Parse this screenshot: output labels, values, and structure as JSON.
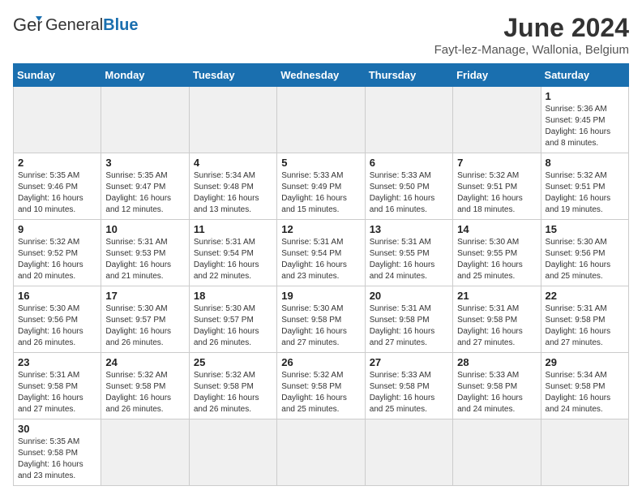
{
  "header": {
    "logo_general": "General",
    "logo_blue": "Blue",
    "title": "June 2024",
    "location": "Fayt-lez-Manage, Wallonia, Belgium"
  },
  "days_of_week": [
    "Sunday",
    "Monday",
    "Tuesday",
    "Wednesday",
    "Thursday",
    "Friday",
    "Saturday"
  ],
  "weeks": [
    [
      {
        "day": "",
        "info": ""
      },
      {
        "day": "",
        "info": ""
      },
      {
        "day": "",
        "info": ""
      },
      {
        "day": "",
        "info": ""
      },
      {
        "day": "",
        "info": ""
      },
      {
        "day": "",
        "info": ""
      },
      {
        "day": "1",
        "info": "Sunrise: 5:36 AM\nSunset: 9:45 PM\nDaylight: 16 hours and 8 minutes."
      }
    ],
    [
      {
        "day": "2",
        "info": "Sunrise: 5:35 AM\nSunset: 9:46 PM\nDaylight: 16 hours and 10 minutes."
      },
      {
        "day": "3",
        "info": "Sunrise: 5:35 AM\nSunset: 9:47 PM\nDaylight: 16 hours and 12 minutes."
      },
      {
        "day": "4",
        "info": "Sunrise: 5:34 AM\nSunset: 9:48 PM\nDaylight: 16 hours and 13 minutes."
      },
      {
        "day": "5",
        "info": "Sunrise: 5:33 AM\nSunset: 9:49 PM\nDaylight: 16 hours and 15 minutes."
      },
      {
        "day": "6",
        "info": "Sunrise: 5:33 AM\nSunset: 9:50 PM\nDaylight: 16 hours and 16 minutes."
      },
      {
        "day": "7",
        "info": "Sunrise: 5:32 AM\nSunset: 9:51 PM\nDaylight: 16 hours and 18 minutes."
      },
      {
        "day": "8",
        "info": "Sunrise: 5:32 AM\nSunset: 9:51 PM\nDaylight: 16 hours and 19 minutes."
      }
    ],
    [
      {
        "day": "9",
        "info": "Sunrise: 5:32 AM\nSunset: 9:52 PM\nDaylight: 16 hours and 20 minutes."
      },
      {
        "day": "10",
        "info": "Sunrise: 5:31 AM\nSunset: 9:53 PM\nDaylight: 16 hours and 21 minutes."
      },
      {
        "day": "11",
        "info": "Sunrise: 5:31 AM\nSunset: 9:54 PM\nDaylight: 16 hours and 22 minutes."
      },
      {
        "day": "12",
        "info": "Sunrise: 5:31 AM\nSunset: 9:54 PM\nDaylight: 16 hours and 23 minutes."
      },
      {
        "day": "13",
        "info": "Sunrise: 5:31 AM\nSunset: 9:55 PM\nDaylight: 16 hours and 24 minutes."
      },
      {
        "day": "14",
        "info": "Sunrise: 5:30 AM\nSunset: 9:55 PM\nDaylight: 16 hours and 25 minutes."
      },
      {
        "day": "15",
        "info": "Sunrise: 5:30 AM\nSunset: 9:56 PM\nDaylight: 16 hours and 25 minutes."
      }
    ],
    [
      {
        "day": "16",
        "info": "Sunrise: 5:30 AM\nSunset: 9:56 PM\nDaylight: 16 hours and 26 minutes."
      },
      {
        "day": "17",
        "info": "Sunrise: 5:30 AM\nSunset: 9:57 PM\nDaylight: 16 hours and 26 minutes."
      },
      {
        "day": "18",
        "info": "Sunrise: 5:30 AM\nSunset: 9:57 PM\nDaylight: 16 hours and 26 minutes."
      },
      {
        "day": "19",
        "info": "Sunrise: 5:30 AM\nSunset: 9:58 PM\nDaylight: 16 hours and 27 minutes."
      },
      {
        "day": "20",
        "info": "Sunrise: 5:31 AM\nSunset: 9:58 PM\nDaylight: 16 hours and 27 minutes."
      },
      {
        "day": "21",
        "info": "Sunrise: 5:31 AM\nSunset: 9:58 PM\nDaylight: 16 hours and 27 minutes."
      },
      {
        "day": "22",
        "info": "Sunrise: 5:31 AM\nSunset: 9:58 PM\nDaylight: 16 hours and 27 minutes."
      }
    ],
    [
      {
        "day": "23",
        "info": "Sunrise: 5:31 AM\nSunset: 9:58 PM\nDaylight: 16 hours and 27 minutes."
      },
      {
        "day": "24",
        "info": "Sunrise: 5:32 AM\nSunset: 9:58 PM\nDaylight: 16 hours and 26 minutes."
      },
      {
        "day": "25",
        "info": "Sunrise: 5:32 AM\nSunset: 9:58 PM\nDaylight: 16 hours and 26 minutes."
      },
      {
        "day": "26",
        "info": "Sunrise: 5:32 AM\nSunset: 9:58 PM\nDaylight: 16 hours and 25 minutes."
      },
      {
        "day": "27",
        "info": "Sunrise: 5:33 AM\nSunset: 9:58 PM\nDaylight: 16 hours and 25 minutes."
      },
      {
        "day": "28",
        "info": "Sunrise: 5:33 AM\nSunset: 9:58 PM\nDaylight: 16 hours and 24 minutes."
      },
      {
        "day": "29",
        "info": "Sunrise: 5:34 AM\nSunset: 9:58 PM\nDaylight: 16 hours and 24 minutes."
      }
    ],
    [
      {
        "day": "30",
        "info": "Sunrise: 5:35 AM\nSunset: 9:58 PM\nDaylight: 16 hours and 23 minutes."
      },
      {
        "day": "",
        "info": ""
      },
      {
        "day": "",
        "info": ""
      },
      {
        "day": "",
        "info": ""
      },
      {
        "day": "",
        "info": ""
      },
      {
        "day": "",
        "info": ""
      },
      {
        "day": "",
        "info": ""
      }
    ]
  ]
}
